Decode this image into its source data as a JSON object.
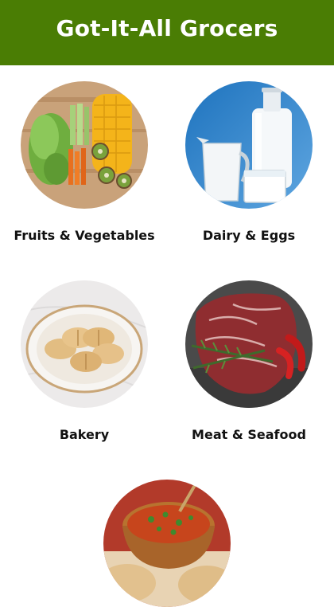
{
  "header": {
    "title": "Got-It-All Grocers"
  },
  "categories": [
    {
      "label": "Fruits & Vegetables",
      "image": "produce-photo"
    },
    {
      "label": "Dairy & Eggs",
      "image": "milk-photo"
    },
    {
      "label": "Bakery",
      "image": "bread-basket-photo"
    },
    {
      "label": "Meat & Seafood",
      "image": "raw-steak-photo"
    },
    {
      "label": "",
      "image": "curry-bowl-photo"
    }
  ],
  "colors": {
    "header_bg": "#4a7d04",
    "header_text": "#ffffff",
    "label_text": "#111111"
  }
}
